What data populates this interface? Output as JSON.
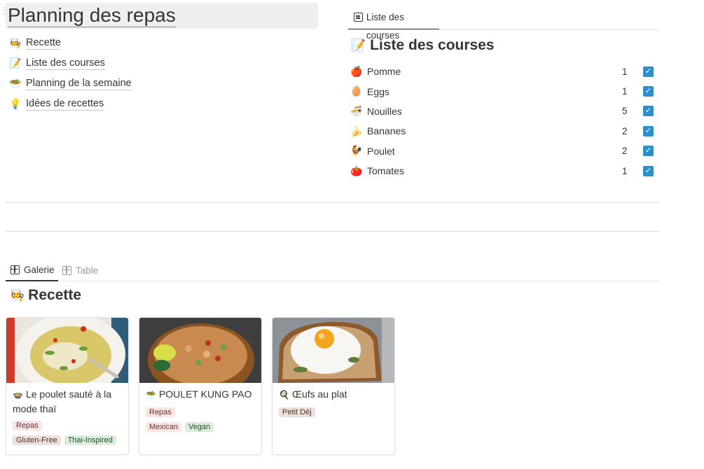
{
  "page": {
    "title": "Planning des repas"
  },
  "nav": [
    {
      "label": "Recette",
      "emoji": "🧑‍🍳",
      "icon": "chef-book-icon"
    },
    {
      "label": "Liste des courses",
      "emoji": "📝",
      "icon": "memo-icon"
    },
    {
      "label": "Planning de la semaine",
      "emoji": "🥗",
      "icon": "food-icon"
    },
    {
      "label": "Idées de recettes",
      "emoji": "💡",
      "icon": "lightbulb-icon"
    }
  ],
  "shopping": {
    "tab_label": "Liste des courses",
    "heading": "Liste des courses",
    "heading_emoji": "📝",
    "items": [
      {
        "emoji": "🍎",
        "name": "Pomme",
        "qty": "1",
        "checked": true
      },
      {
        "emoji": "🥚",
        "name": "Eggs",
        "qty": "1",
        "checked": true
      },
      {
        "emoji": "🍜",
        "name": "Nouilles",
        "qty": "5",
        "checked": true
      },
      {
        "emoji": "🍌",
        "name": "Bananes",
        "qty": "2",
        "checked": true
      },
      {
        "emoji": "🐓",
        "name": "Poulet",
        "qty": "2",
        "checked": true
      },
      {
        "emoji": "🍅",
        "name": "Tomates",
        "qty": "1",
        "checked": true
      }
    ]
  },
  "views": {
    "gallery_label": "Galerie",
    "table_label": "Table"
  },
  "recipes": {
    "title": "Recette",
    "title_emoji": "🧑‍🍳",
    "cards": [
      {
        "emoji": "🍲",
        "title": "Le poulet sauté à la mode thaï",
        "tags_row1": [
          "Repas"
        ],
        "tags_row2": [
          "Gluten-Free",
          "Thai-Inspired"
        ]
      },
      {
        "emoji": "🥗",
        "title": "POULET KUNG PAO",
        "tags_row1": [
          "Repas"
        ],
        "tags_row2": [
          "Mexican",
          "Vegan"
        ]
      },
      {
        "emoji": "🍳",
        "title": "Œufs au plat",
        "tags_row1": [
          "Petit Déj"
        ],
        "tags_row2": []
      }
    ]
  },
  "colors": {
    "checkbox": "#2e8fcc",
    "tag_red": "#fbe4e4",
    "tag_brown": "#eee0da",
    "tag_green": "#dbeddb"
  }
}
